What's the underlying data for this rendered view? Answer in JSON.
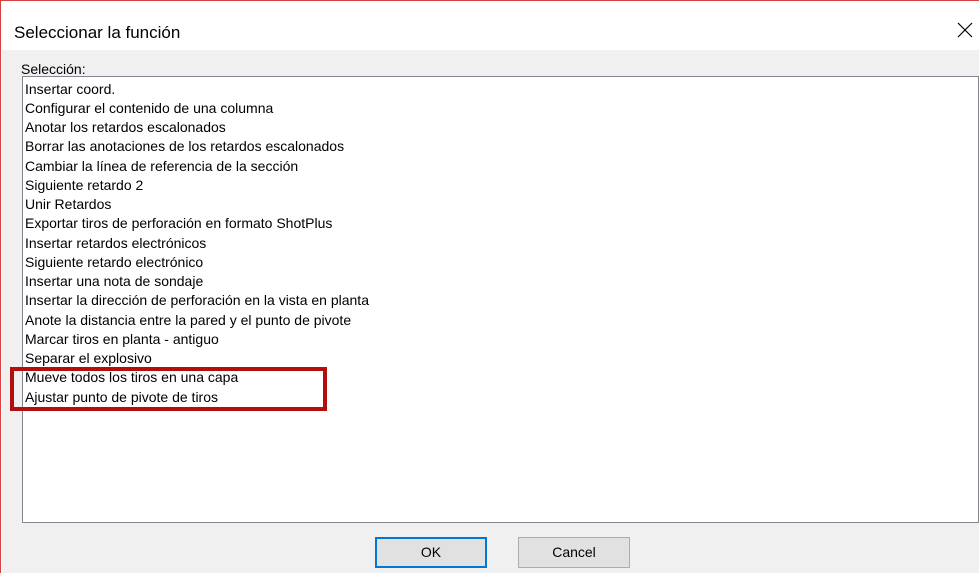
{
  "dialog": {
    "title": "Seleccionar la función",
    "close_icon": "close-icon"
  },
  "selection": {
    "label": "Selección:",
    "items": [
      "Insertar coord.",
      "Configurar el contenido de una columna",
      "Anotar los retardos escalonados",
      "Borrar las anotaciones de los retardos escalonados",
      "Cambiar la línea de referencia de la sección",
      "Siguiente retardo 2",
      "Unir Retardos",
      "Exportar tiros de perforación en formato ShotPlus",
      "Insertar retardos electrónicos",
      "Siguiente retardo electrónico",
      "Insertar una nota de sondaje",
      "Insertar la dirección de perforación en la vista en planta",
      "Anote la distancia entre la pared y el punto de pivote",
      "Marcar tiros en planta - antiguo",
      "Separar el explosivo",
      "Mueve todos los tiros en una capa",
      "Ajustar punto de pivote de tiros"
    ]
  },
  "buttons": {
    "ok_label": "OK",
    "cancel_label": "Cancel"
  },
  "colors": {
    "annotation_border": "#b30d0d",
    "ok_focus_border": "#0078d7",
    "window_border": "#d64040"
  }
}
